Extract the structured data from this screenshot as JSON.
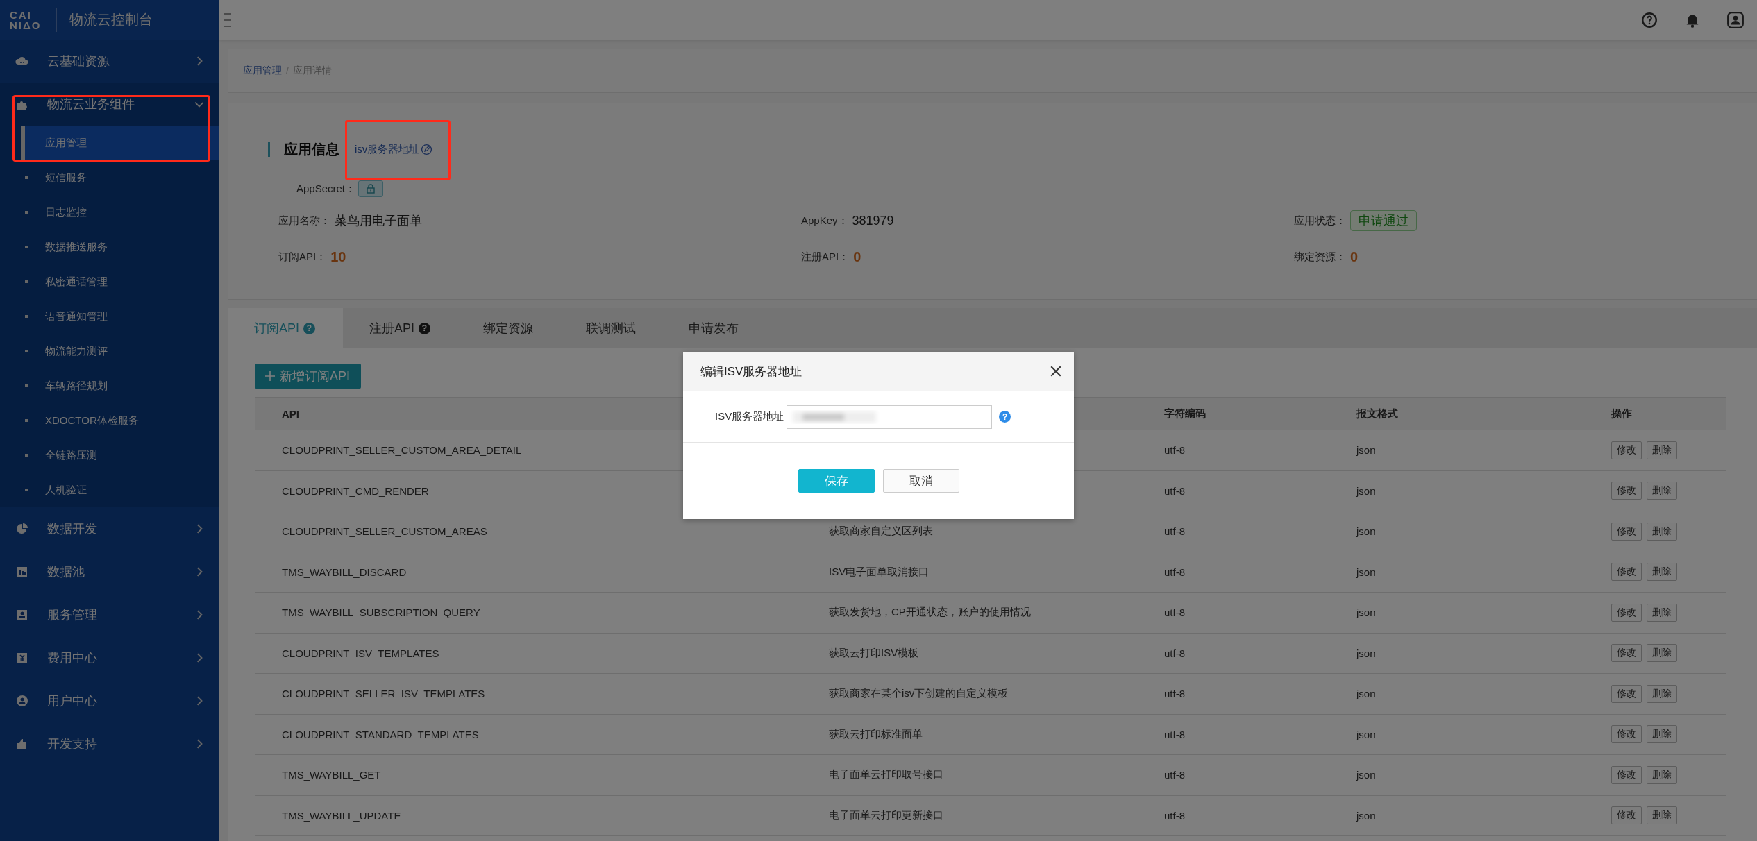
{
  "header": {
    "logo_lines": [
      "CAI",
      "NIΔO"
    ],
    "title": "物流云控制台"
  },
  "sidebar": {
    "groups": [
      {
        "label": "云基础资源",
        "expanded": false,
        "highlighted": false
      },
      {
        "label": "物流云业务组件",
        "expanded": true,
        "highlighted": true,
        "children": [
          {
            "label": "应用管理",
            "selected": true
          },
          {
            "label": "短信服务",
            "selected": false
          },
          {
            "label": "日志监控",
            "selected": false
          },
          {
            "label": "数据推送服务",
            "selected": false
          },
          {
            "label": "私密通话管理",
            "selected": false
          },
          {
            "label": "语音通知管理",
            "selected": false
          },
          {
            "label": "物流能力测评",
            "selected": false
          },
          {
            "label": "车辆路径规划",
            "selected": false
          },
          {
            "label": "XDOCTOR体检服务",
            "selected": false
          },
          {
            "label": "全链路压测",
            "selected": false
          },
          {
            "label": "人机验证",
            "selected": false
          }
        ]
      },
      {
        "label": "数据开发",
        "expanded": false,
        "highlighted": false
      },
      {
        "label": "数据池",
        "expanded": false,
        "highlighted": false
      },
      {
        "label": "服务管理",
        "expanded": false,
        "highlighted": false
      },
      {
        "label": "费用中心",
        "expanded": false,
        "highlighted": false
      },
      {
        "label": "用户中心",
        "expanded": false,
        "highlighted": false
      },
      {
        "label": "开发支持",
        "expanded": false,
        "highlighted": false
      }
    ]
  },
  "breadcrumb": [
    {
      "label": "应用管理",
      "current": false
    },
    {
      "label": "应用详情",
      "current": true
    }
  ],
  "breadcrumb_separator": "/",
  "app_info": {
    "title": "应用信息",
    "server_link": {
      "label": "isv服务器地址",
      "highlighted": true
    },
    "secret_label": "AppSecret：",
    "fields": [
      {
        "label": "应用名称：",
        "value": "菜鸟用电子面单",
        "kind": "text"
      },
      {
        "label": "AppKey：",
        "value": "381979",
        "kind": "text"
      },
      {
        "label": "应用状态：",
        "value": "申请通过",
        "kind": "tag"
      },
      {
        "label": "订阅API：",
        "value": "10",
        "kind": "count"
      },
      {
        "label": "注册API：",
        "value": "0",
        "kind": "count"
      },
      {
        "label": "绑定资源：",
        "value": "0",
        "kind": "count"
      }
    ]
  },
  "tabs": [
    {
      "label": "订阅API",
      "selected": true,
      "help": "?"
    },
    {
      "label": "注册API",
      "selected": false,
      "help": "?"
    },
    {
      "label": "绑定资源",
      "selected": false
    },
    {
      "label": "联调测试",
      "selected": false
    },
    {
      "label": "申请发布",
      "selected": false
    }
  ],
  "add_button": {
    "label": "新增订阅API"
  },
  "table": {
    "columns": [
      "API",
      "字符编码",
      "报文格式",
      "操作"
    ],
    "rows": [
      {
        "api": "CLOUDPRINT_SELLER_CUSTOM_AREA_DETAIL",
        "charset": "utf-8",
        "format": "json",
        "actions": [
          "修改",
          "删除"
        ]
      },
      {
        "api": "CLOUDPRINT_CMD_RENDER",
        "charset": "utf-8",
        "format": "json",
        "actions": [
          "修改",
          "删除"
        ]
      },
      {
        "api": "CLOUDPRINT_SELLER_CUSTOM_AREAS",
        "description": "获取商家自定义区列表",
        "charset": "utf-8",
        "format": "json",
        "actions": [
          "修改",
          "删除"
        ]
      },
      {
        "api": "TMS_WAYBILL_DISCARD",
        "description": "ISV电子面单取消接口",
        "charset": "utf-8",
        "format": "json",
        "actions": [
          "修改",
          "删除"
        ]
      },
      {
        "api": "TMS_WAYBILL_SUBSCRIPTION_QUERY",
        "description": "获取发货地，CP开通状态，账户的使用情况",
        "charset": "utf-8",
        "format": "json",
        "actions": [
          "修改",
          "删除"
        ]
      },
      {
        "api": "CLOUDPRINT_ISV_TEMPLATES",
        "description": "获取云打印ISV模板",
        "charset": "utf-8",
        "format": "json",
        "actions": [
          "修改",
          "删除"
        ]
      },
      {
        "api": "CLOUDPRINT_SELLER_ISV_TEMPLATES",
        "description": "获取商家在某个isv下创建的自定义模板",
        "charset": "utf-8",
        "format": "json",
        "actions": [
          "修改",
          "删除"
        ]
      },
      {
        "api": "CLOUDPRINT_STANDARD_TEMPLATES",
        "description": "获取云打印标准面单",
        "charset": "utf-8",
        "format": "json",
        "actions": [
          "修改",
          "删除"
        ]
      },
      {
        "api": "TMS_WAYBILL_GET",
        "description": "电子面单云打印取号接口",
        "charset": "utf-8",
        "format": "json",
        "actions": [
          "修改",
          "删除"
        ]
      },
      {
        "api": "TMS_WAYBILL_UPDATE",
        "description": "电子面单云打印更新接口",
        "charset": "utf-8",
        "format": "json",
        "actions": [
          "修改",
          "删除"
        ]
      }
    ]
  },
  "modal": {
    "title": "编辑ISV服务器地址",
    "field_label": "ISV服务器地址",
    "value_redacted": true,
    "help": "?",
    "buttons": [
      {
        "label": "保存",
        "kind": "primary"
      },
      {
        "label": "取消",
        "kind": "default"
      }
    ]
  }
}
